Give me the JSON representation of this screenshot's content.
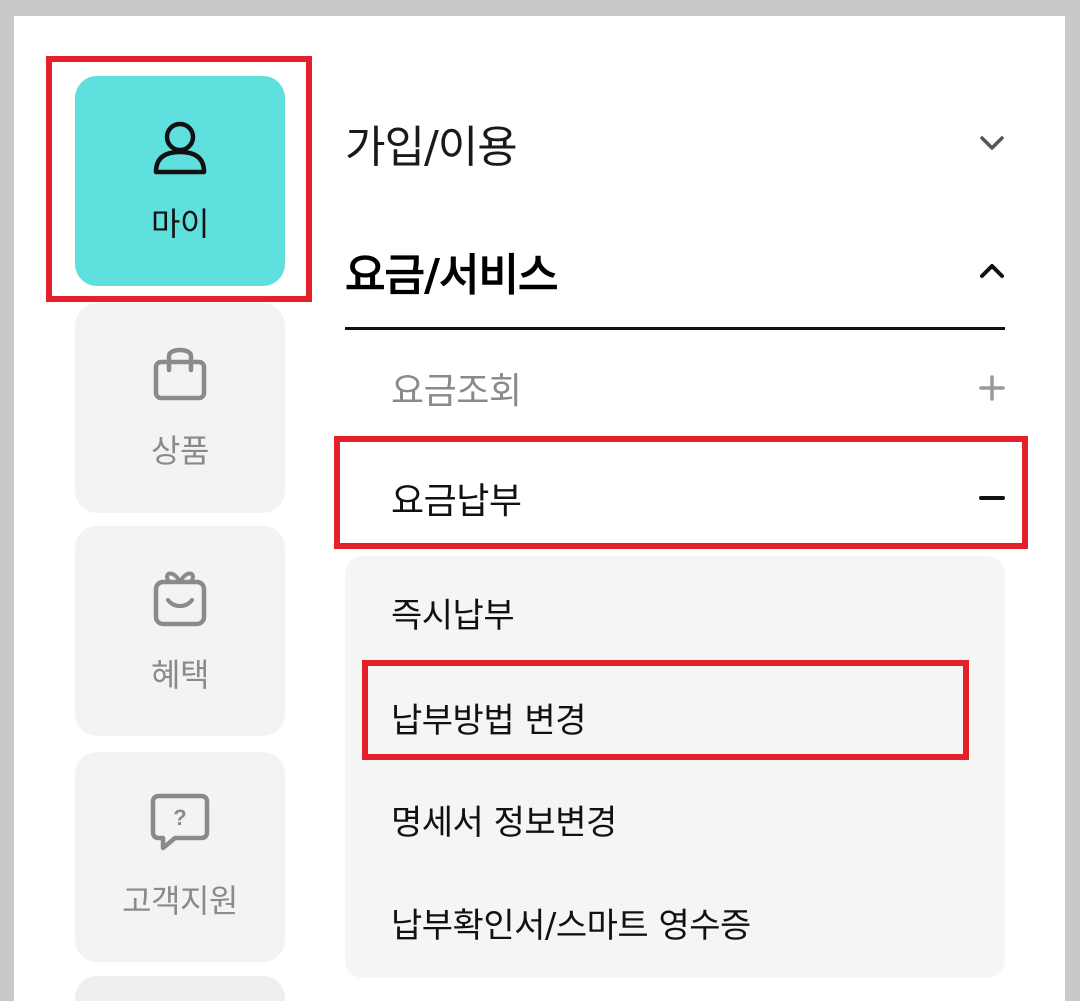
{
  "sidebar": {
    "items": [
      {
        "label": "마이",
        "icon": "user-icon",
        "active": true
      },
      {
        "label": "상품",
        "icon": "shopping-bag-icon",
        "active": false
      },
      {
        "label": "혜택",
        "icon": "gift-icon",
        "active": false
      },
      {
        "label": "고객지원",
        "icon": "help-chat-icon",
        "active": false
      }
    ]
  },
  "menu": {
    "sections": [
      {
        "label": "가입/이용",
        "state": "collapsed",
        "toggle_icon": "chevron-down-icon"
      },
      {
        "label": "요금/서비스",
        "state": "expanded",
        "toggle_icon": "chevron-up-icon"
      }
    ],
    "subsections": [
      {
        "label": "요금조회",
        "toggle": "+",
        "toggle_icon": "plus-icon"
      },
      {
        "label": "요금납부",
        "toggle": "−",
        "toggle_icon": "minus-icon"
      }
    ],
    "leaves": [
      {
        "label": "즉시납부"
      },
      {
        "label": "납부방법 변경"
      },
      {
        "label": "명세서 정보변경"
      },
      {
        "label": "납부확인서/스마트 영수증"
      }
    ]
  },
  "colors": {
    "accent_active_tile": "#5fe0de",
    "highlight_box": "#e5202b",
    "inactive_tile": "#f3f3f3",
    "submenu_panel": "#f5f5f6"
  }
}
